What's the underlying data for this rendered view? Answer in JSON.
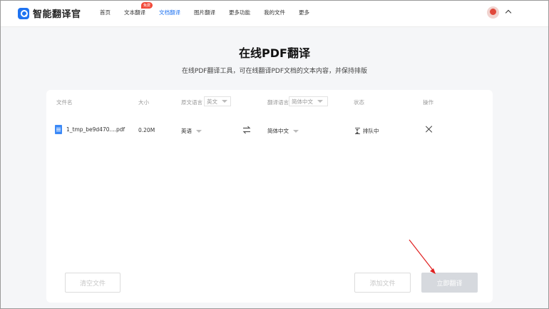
{
  "app": {
    "name": "智能翻译官"
  },
  "nav": {
    "items": [
      {
        "label": "首页",
        "active": false
      },
      {
        "label": "文本翻译",
        "active": false,
        "badge": "免费"
      },
      {
        "label": "文档翻译",
        "active": true
      },
      {
        "label": "图片翻译",
        "active": false
      },
      {
        "label": "更多功能",
        "active": false
      },
      {
        "label": "我的文件",
        "active": false
      },
      {
        "label": "更多",
        "active": false
      }
    ]
  },
  "page": {
    "title": "在线PDF翻译",
    "subtitle": "在线PDF翻译工具，可在线翻译PDF文档的文本内容，并保持排版"
  },
  "table": {
    "headers": {
      "filename": "文件名",
      "size": "大小",
      "source_lang": "原文语言",
      "target_lang": "翻译语言",
      "status": "状态",
      "action": "操作"
    },
    "header_source_value": "英文",
    "header_target_value": "简体中文",
    "rows": [
      {
        "filename": "1_tmp_be9d470....pdf",
        "size": "0.20M",
        "source_lang": "英语",
        "target_lang": "简体中文",
        "status": "排队中"
      }
    ]
  },
  "buttons": {
    "clear": "清空文件",
    "add": "添加文件",
    "translate": "立即翻译"
  },
  "colors": {
    "accent": "#1f73f1",
    "badge": "#f24a3a",
    "arrow": "#e02020"
  }
}
